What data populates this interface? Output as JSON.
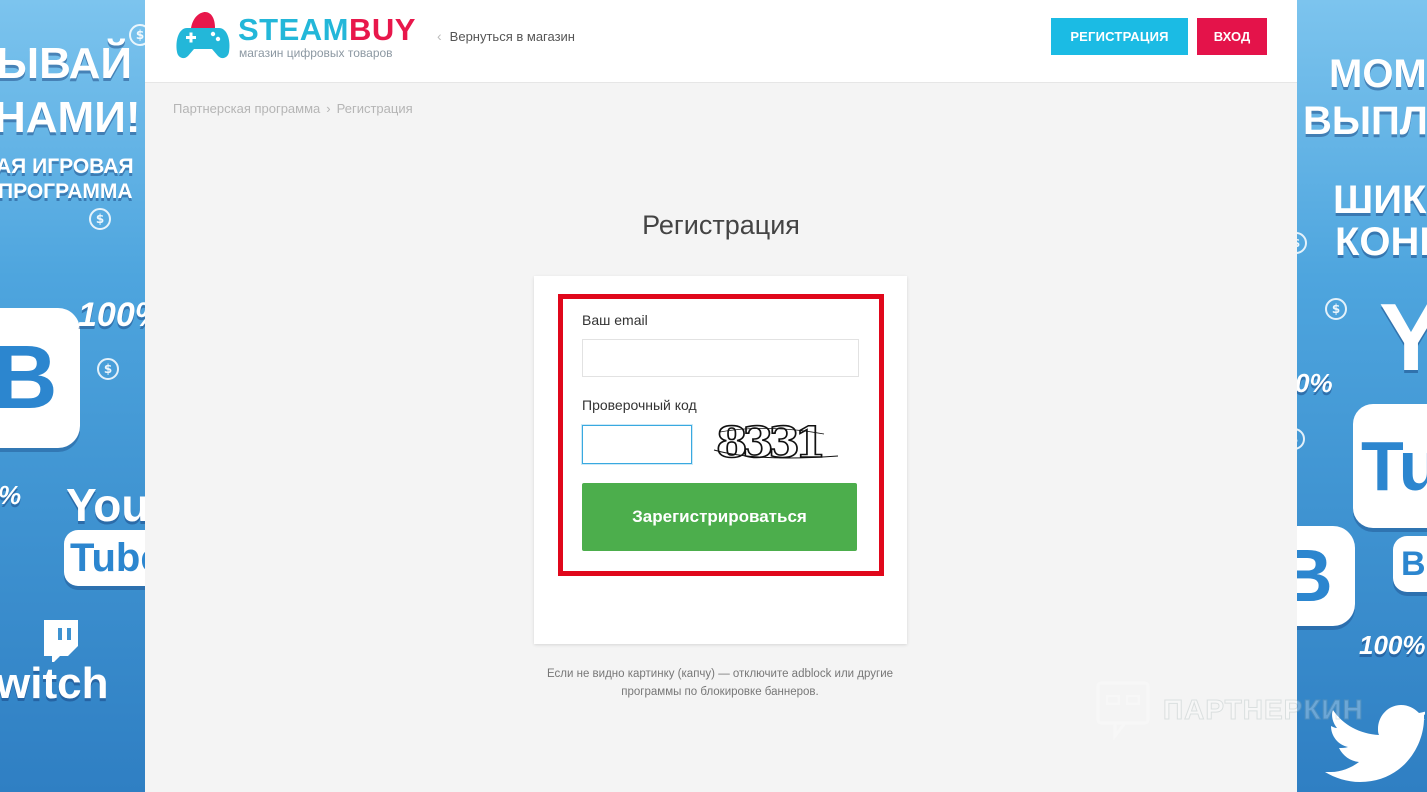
{
  "banner_left": {
    "line1": "ЫВАЙ",
    "line2": "НАМИ!",
    "line3": "АЯ ИГРОВАЯ",
    "line4": "ПРОГРАММА",
    "percent": "100%",
    "percent_small": "%",
    "vk": "B",
    "youtube_you": "You",
    "youtube_tube": "Tube",
    "twitch": "witch",
    "coin": "$"
  },
  "banner_right": {
    "line1": "МОМ",
    "line2": "ВЫПЛ",
    "line3": "ШИКА",
    "line4": "КОНВ",
    "percent": "100%",
    "percent_small": "0%",
    "youtube_y": "Y",
    "youtube_tu": "Tu",
    "vk": "B",
    "vk_small": "B",
    "coin": "$"
  },
  "header": {
    "logo_steam": "STEAM",
    "logo_buy": "BUY",
    "logo_subtitle": "магазин цифровых товаров",
    "back_link": "Вернуться в магазин",
    "register_button": "РЕГИСТРАЦИЯ",
    "login_button": "ВХОД"
  },
  "breadcrumb": {
    "items": [
      "Партнерская программа",
      "Регистрация"
    ],
    "separator": "›"
  },
  "page_title": "Регистрация",
  "form": {
    "email_label": "Ваш email",
    "email_value": "",
    "code_label": "Проверочный код",
    "code_value": "",
    "captcha_text": "8331",
    "submit_label": "Зарегистрироваться"
  },
  "note": {
    "line1": "Если не видно картинку (капчу) — отключите adblock или другие",
    "line2": "программы по блокировке баннеров."
  },
  "watermark": "ПАРТНЕРКИН",
  "colors": {
    "brand_cyan": "#1bbbe4",
    "brand_red": "#e4134a",
    "submit_green": "#4cae4c",
    "highlight_red": "#e0071b"
  }
}
